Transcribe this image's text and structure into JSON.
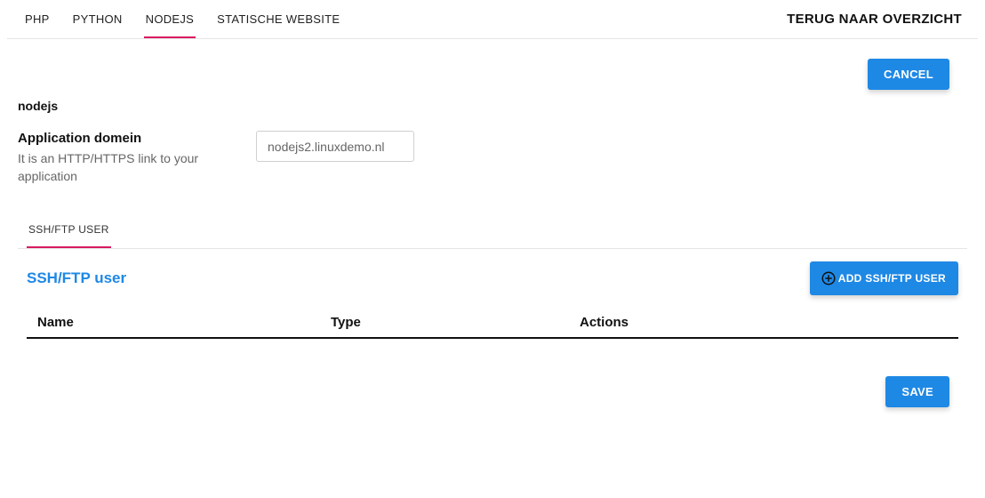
{
  "topTabs": {
    "php": "PHP",
    "python": "PYTHON",
    "nodejs": "NODEJS",
    "static": "STATISCHE WEBSITE"
  },
  "backLink": "TERUG NAAR OVERZICHT",
  "buttons": {
    "cancel": "CANCEL",
    "save": "SAVE",
    "addUser": "ADD SSH/FTP USER"
  },
  "section": {
    "title": "nodejs",
    "domainLabel": "Application domein",
    "domainHint": "It is an HTTP/HTTPS link to your application",
    "domainValue": "nodejs2.linuxdemo.nl"
  },
  "subTabs": {
    "sshftp": "SSH/FTP USER"
  },
  "userSection": {
    "heading": "SSH/FTP user"
  },
  "table": {
    "colName": "Name",
    "colType": "Type",
    "colActions": "Actions"
  }
}
